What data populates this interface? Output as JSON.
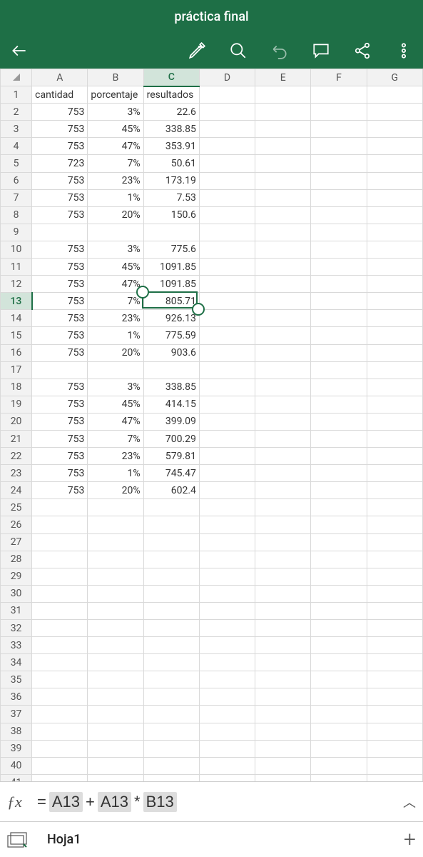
{
  "title": "práctica final",
  "toolbar": {
    "back": "←",
    "draw": "✎",
    "search": "⌕",
    "undo": "↶",
    "comment": "💬",
    "share": "share",
    "more": "⋮"
  },
  "columns": [
    "A",
    "B",
    "C",
    "D",
    "E",
    "F",
    "G"
  ],
  "rowCount": 41,
  "selectedCell": {
    "row": 13,
    "col": "C"
  },
  "data": {
    "1": {
      "A": "cantidad",
      "B": "porcentaje",
      "C": "resultados"
    },
    "2": {
      "A": "753",
      "B": "3%",
      "C": "22.6"
    },
    "3": {
      "A": "753",
      "B": "45%",
      "C": "338.85"
    },
    "4": {
      "A": "753",
      "B": "47%",
      "C": "353.91"
    },
    "5": {
      "A": "723",
      "B": "7%",
      "C": "50.61"
    },
    "6": {
      "A": "753",
      "B": "23%",
      "C": "173.19"
    },
    "7": {
      "A": "753",
      "B": "1%",
      "C": "7.53"
    },
    "8": {
      "A": "753",
      "B": "20%",
      "C": "150.6"
    },
    "9": {},
    "10": {
      "A": "753",
      "B": "3%",
      "C": "775.6"
    },
    "11": {
      "A": "753",
      "B": "45%",
      "C": "1091.85"
    },
    "12": {
      "A": "753",
      "B": "47%",
      "C": "1091.85"
    },
    "13": {
      "A": "753",
      "B": "7%",
      "C": "805.71"
    },
    "14": {
      "A": "753",
      "B": "23%",
      "C": "926.13"
    },
    "15": {
      "A": "753",
      "B": "1%",
      "C": "775.59"
    },
    "16": {
      "A": "753",
      "B": "20%",
      "C": "903.6"
    },
    "17": {},
    "18": {
      "A": "753",
      "B": "3%",
      "C": "338.85"
    },
    "19": {
      "A": "753",
      "B": "45%",
      "C": "414.15"
    },
    "20": {
      "A": "753",
      "B": "47%",
      "C": "399.09"
    },
    "21": {
      "A": "753",
      "B": "7%",
      "C": "700.29"
    },
    "22": {
      "A": "753",
      "B": "23%",
      "C": "579.81"
    },
    "23": {
      "A": "753",
      "B": "1%",
      "C": "745.47"
    },
    "24": {
      "A": "753",
      "B": "20%",
      "C": "602.4"
    }
  },
  "formula": {
    "eq": "=",
    "ref1": "A13",
    "plus": "+",
    "ref2": "A13",
    "mult": "*",
    "ref3": "B13"
  },
  "sheet": {
    "name": "Hoja1"
  }
}
